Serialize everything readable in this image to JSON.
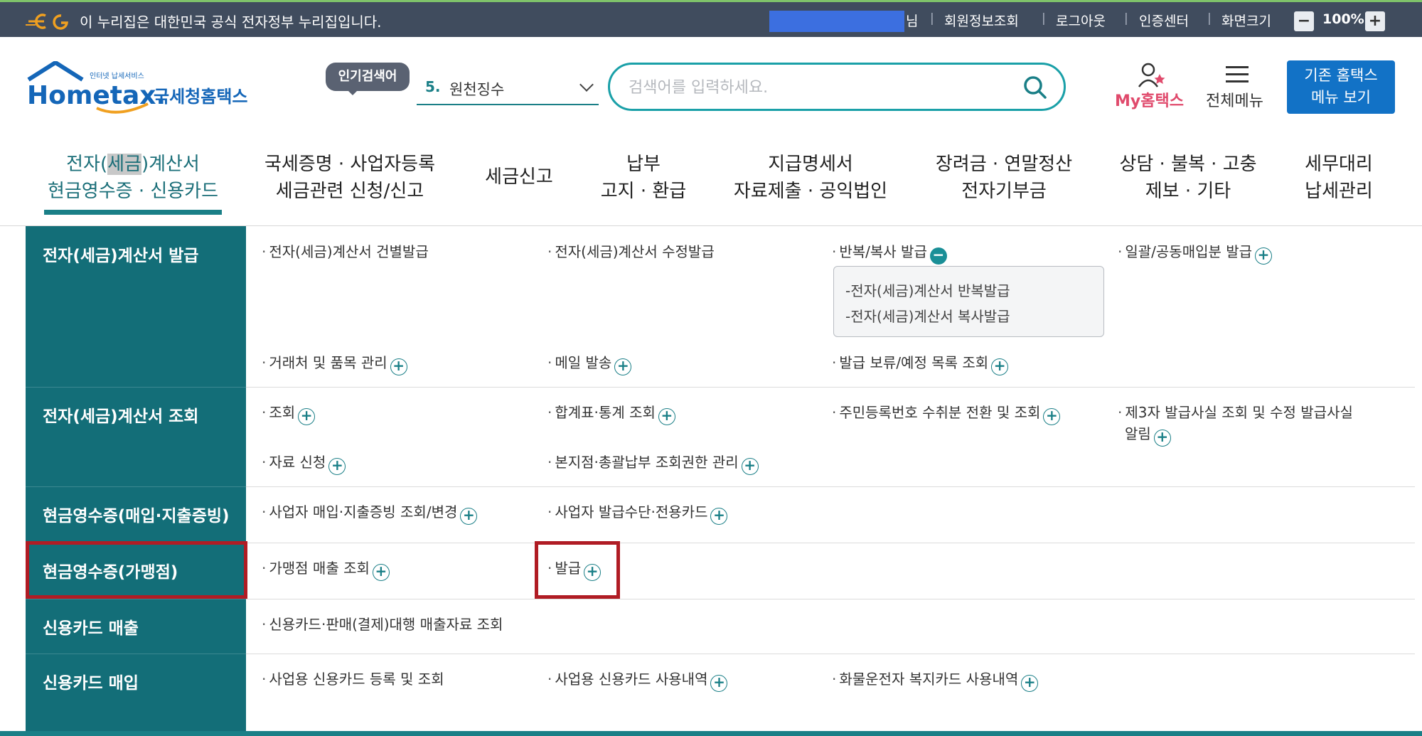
{
  "gov_bar": {
    "notice": "이 누리집은 대한민국 공식 전자정부 누리집입니다.",
    "user_suffix": "님",
    "links": [
      "회원정보조회",
      "로그아웃",
      "인증센터",
      "화면크기"
    ],
    "zoom_minus": "−",
    "zoom_value": "100%",
    "zoom_plus": "+"
  },
  "header": {
    "logo_small": "인터넷 납세서비스",
    "logo_main": "Hometax.",
    "logo_kor": "국세청홈택스",
    "popular_label": "인기검색어",
    "popular_rank": "5.",
    "popular_word": "원천징수",
    "search_placeholder": "검색어를 입력하세요.",
    "my_label": "My홈택스",
    "menu_label": "전체메뉴",
    "classic_line1": "기존 홈택스",
    "classic_line2": "메뉴 보기"
  },
  "nav": [
    {
      "l1a": "전자(",
      "l1hl": "세금",
      "l1b": ")계산서",
      "l2": "현금영수증 · 신용카드"
    },
    {
      "l1": "국세증명 · 사업자등록",
      "l2": "세금관련 신청/신고"
    },
    {
      "l1": "세금신고"
    },
    {
      "l1": "납부",
      "l2": "고지 · 환급"
    },
    {
      "l1": "지급명세서",
      "l2": "자료제출 · 공익법인"
    },
    {
      "l1": "장려금 · 연말정산",
      "l2": "전자기부금"
    },
    {
      "l1": "상담 · 불복 · 고충",
      "l2": "제보 · 기타"
    },
    {
      "l1": "세무대리",
      "l2": "납세관리"
    }
  ],
  "submenu": {
    "categories": [
      "전자(세금)계산서 발급",
      "전자(세금)계산서 조회",
      "현금영수증(매입·지출증빙)",
      "현금영수증(가맹점)",
      "신용카드 매출",
      "신용카드 매입"
    ],
    "issue": {
      "single": "전자(세금)계산서 건별발급",
      "modify": "전자(세금)계산서 수정발급",
      "repeat": "반복/복사 발급",
      "bulk": "일괄/공동매입분 발급",
      "repeat_sub1": "전자(세금)계산서 반복발급",
      "repeat_sub2": "전자(세금)계산서 복사발급",
      "partners": "거래처 및 품목 관리",
      "mail": "메일 발송",
      "hold": "발급 보류/예정 목록 조회"
    },
    "inquiry": {
      "search": "조회",
      "stats": "합계표·통계 조회",
      "rrn": "주민등록번호 수취분 전환 및 조회",
      "third1": "제3자 발급사실 조회 및 수정 발급사실",
      "third2": "알림",
      "request": "자료 신청",
      "branch": "본지점·총괄납부 조회권한 관리"
    },
    "cash_buy": {
      "purchase": "사업자 매입·지출증빙 조회/변경",
      "card": "사업자 발급수단·전용카드"
    },
    "cash_store": {
      "sales": "가맹점 매출 조회",
      "issue": "발급"
    },
    "card_sales": {
      "pg": "신용카드·판매(결제)대행 매출자료 조회"
    },
    "card_buy": {
      "register": "사업용 신용카드 등록 및 조회",
      "history": "사업용 신용카드 사용내역",
      "cargo": "화물운전자 복지카드 사용내역"
    }
  },
  "colors": {
    "teal": "#136e78",
    "accent": "#1aa0a8",
    "highlight_red": "#b01c24",
    "classic_blue": "#1272c6"
  }
}
